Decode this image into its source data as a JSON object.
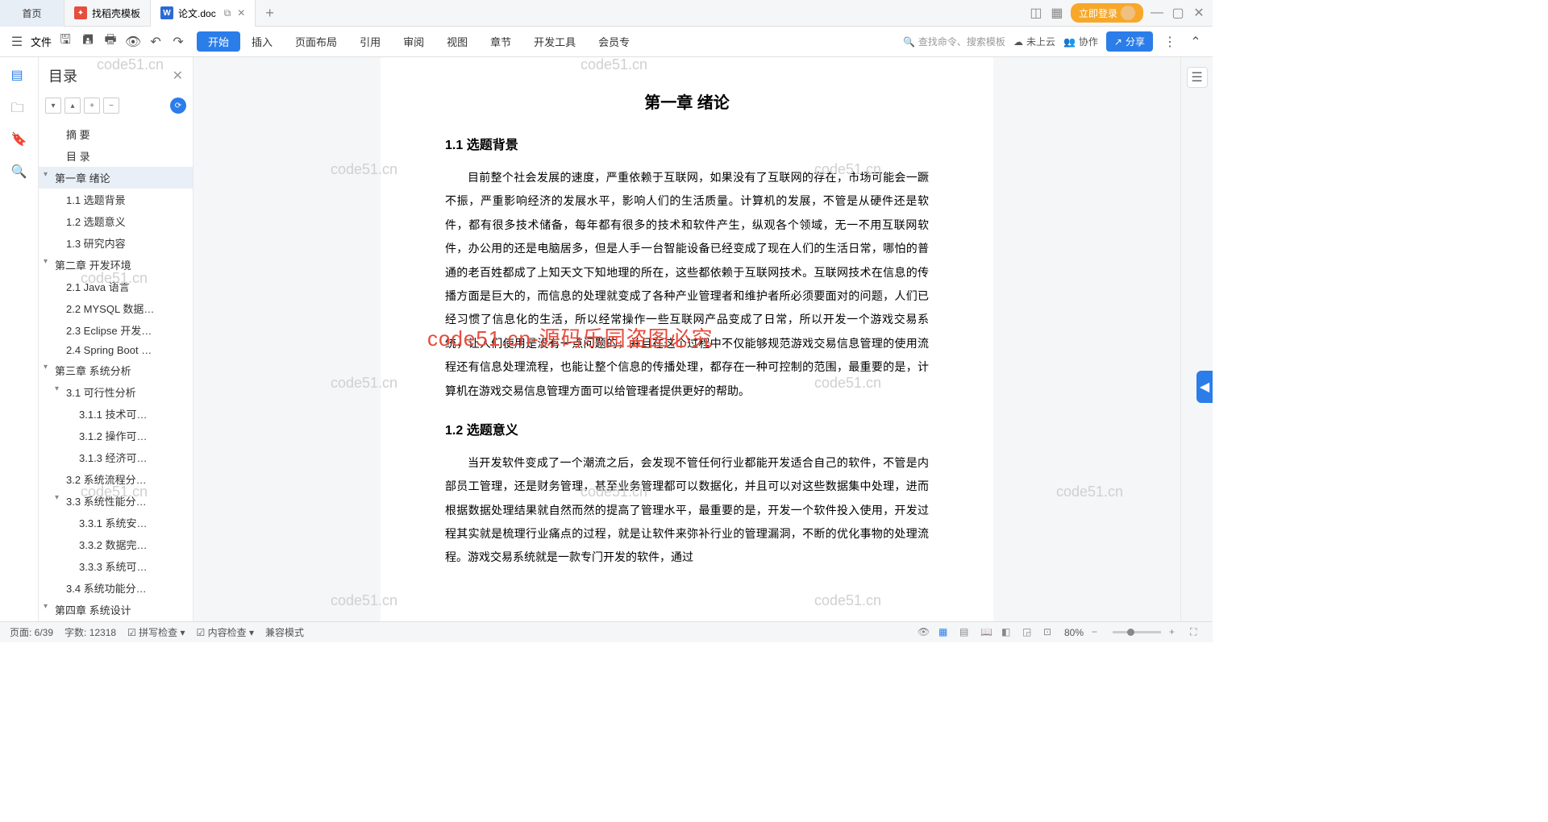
{
  "tabs": {
    "home": "首页",
    "t1": "找稻壳模板",
    "t2": "论文.doc"
  },
  "titleRight": {
    "login": "立即登录"
  },
  "toolbar": {
    "fileLabel": "文件",
    "menu": [
      "开始",
      "插入",
      "页面布局",
      "引用",
      "审阅",
      "视图",
      "章节",
      "开发工具",
      "会员专"
    ],
    "searchPlaceholder": "查找命令、搜索模板",
    "cloud": "未上云",
    "collab": "协作",
    "share": "分享"
  },
  "toc": {
    "title": "目录",
    "items": [
      {
        "label": "摘 要",
        "lvl": 1,
        "plain": true
      },
      {
        "label": "目 录",
        "lvl": 1,
        "plain": true
      },
      {
        "label": "第一章 绪论",
        "lvl": 1,
        "active": true
      },
      {
        "label": "1.1 选题背景",
        "lvl": 2
      },
      {
        "label": "1.2 选题意义",
        "lvl": 2
      },
      {
        "label": "1.3 研究内容",
        "lvl": 2
      },
      {
        "label": "第二章 开发环境",
        "lvl": 1
      },
      {
        "label": "2.1 Java 语言",
        "lvl": 2
      },
      {
        "label": "2.2 MYSQL 数据…",
        "lvl": 2
      },
      {
        "label": "2.3 Eclipse 开发…",
        "lvl": 2
      },
      {
        "label": "2.4 Spring Boot …",
        "lvl": 2
      },
      {
        "label": "第三章 系统分析",
        "lvl": 1
      },
      {
        "label": "3.1 可行性分析",
        "lvl": 2,
        "exp": true
      },
      {
        "label": "3.1.1 技术可…",
        "lvl": 3
      },
      {
        "label": "3.1.2 操作可…",
        "lvl": 3
      },
      {
        "label": "3.1.3 经济可…",
        "lvl": 3
      },
      {
        "label": "3.2 系统流程分…",
        "lvl": 2
      },
      {
        "label": "3.3 系统性能分…",
        "lvl": 2,
        "exp": true
      },
      {
        "label": "3.3.1 系统安…",
        "lvl": 3
      },
      {
        "label": "3.3.2 数据完…",
        "lvl": 3
      },
      {
        "label": "3.3.3 系统可…",
        "lvl": 3
      },
      {
        "label": "3.4 系统功能分…",
        "lvl": 2
      },
      {
        "label": "第四章 系统设计",
        "lvl": 1
      }
    ]
  },
  "document": {
    "chapterTitle": "第一章 绪论",
    "h1_1": "1.1 选题背景",
    "p1": "目前整个社会发展的速度，严重依赖于互联网，如果没有了互联网的存在，市场可能会一蹶不振，严重影响经济的发展水平，影响人们的生活质量。计算机的发展，不管是从硬件还是软件，都有很多技术储备，每年都有很多的技术和软件产生，纵观各个领域，无一不用互联网软件，办公用的还是电脑居多，但是人手一台智能设备已经变成了现在人们的生活日常，哪怕的普通的老百姓都成了上知天文下知地理的所在，这些都依赖于互联网技术。互联网技术在信息的传播方面是巨大的，而信息的处理就变成了各种产业管理者和维护者所必须要面对的问题，人们已经习惯了信息化的生活，所以经常操作一些互联网产品变成了日常，所以开发一个游戏交易系统，让人们使用是没有一点问题的，并且在这个过程中不仅能够规范游戏交易信息管理的使用流程还有信息处理流程，也能让整个信息的传播处理，都存在一种可控制的范围，最重要的是，计算机在游戏交易信息管理方面可以给管理者提供更好的帮助。",
    "h1_2": "1.2 选题意义",
    "p2": "当开发软件变成了一个潮流之后，会发现不管任何行业都能开发适合自己的软件，不管是内部员工管理，还是财务管理，甚至业务管理都可以数据化，并且可以对这些数据集中处理，进而根据数据处理结果就自然而然的提高了管理水平，最重要的是，开发一个软件投入使用，开发过程其实就是梳理行业痛点的过程，就是让软件来弥补行业的管理漏洞，不断的优化事物的处理流程。游戏交易系统就是一款专门开发的软件，通过"
  },
  "status": {
    "page": "页面: 6/39",
    "words": "字数: 12318",
    "spell": "拼写检查",
    "content": "内容检查",
    "compat": "兼容模式",
    "zoom": "80%"
  },
  "watermarks": {
    "wm": "code51.cn",
    "red": "code51.cn-源码乐园盗图必究"
  }
}
